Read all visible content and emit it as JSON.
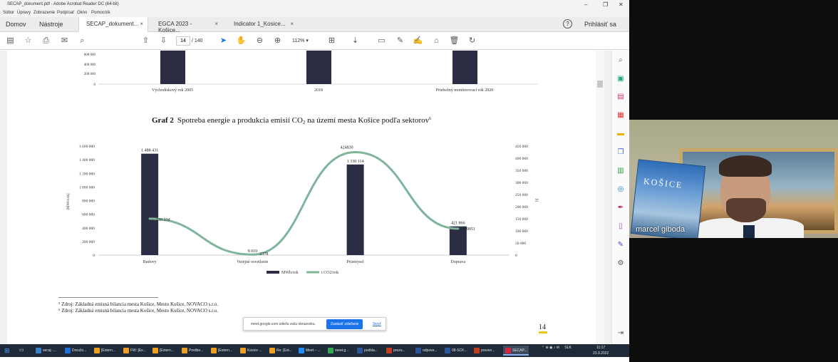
{
  "window": {
    "title": "SECAP_dokument.pdf - Adobe Acrobat Reader DC (64-bit)",
    "min": "–",
    "max": "❐",
    "close": "✕"
  },
  "menu": [
    "Súbor",
    "Úpravy",
    "Zobrazenie",
    "Podpísať",
    "Okno",
    "Pomocník"
  ],
  "tabs": {
    "home": "Domov",
    "tools": "Nástroje",
    "docs": [
      {
        "label": "SECAP_dokument...",
        "active": true
      },
      {
        "label": "EGCA 2023 - Košice...",
        "active": false
      },
      {
        "label": "Indicator 1_Kosice...",
        "active": false
      }
    ],
    "close_glyph": "×",
    "help": "?",
    "login": "Prihlásiť sa"
  },
  "toolbar": {
    "page_current": "14",
    "page_total": "/ 140",
    "zoom": "112%"
  },
  "chart_top": {
    "yticks": [
      "600 000",
      "400 000",
      "200 000",
      "0"
    ],
    "categories": [
      "Východiskový rok 2005",
      "2018",
      "Priebežný monitorovací rok 2020"
    ]
  },
  "chart_data": {
    "type": "bar",
    "title": "Graf 2",
    "subtitle": "Spotreba energie a produkcia emisií CO",
    "subtitle_sub": "2",
    "subtitle_tail": " na území mesta Košice podľa sektorov",
    "subtitle_sup": "6",
    "categories": [
      "Budovy",
      "Verejné osvetlenie",
      "Priemysel",
      "Doprava"
    ],
    "series": [
      {
        "name": "MWh/rok",
        "type": "bar",
        "values": [
          1488431,
          9019,
          1330114,
          421866
        ],
        "color": "#2b2d45"
      },
      {
        "name": "t CO2/rok",
        "type": "line",
        "values": [
          150234,
          2378,
          424830,
          109051
        ],
        "color": "#7fb59a"
      }
    ],
    "bar_labels": [
      "1 488 431",
      "9 019",
      "1 330 114",
      "421 866"
    ],
    "line_labels": [
      "150 234",
      "2378",
      "424830",
      "109051"
    ],
    "ylabel_left": "[MWh/rok]",
    "ylabel_right": "[t]",
    "ylim_left": [
      0,
      1600000
    ],
    "ylim_right": [
      0,
      450000
    ],
    "yticks_left": [
      "1 600 000",
      "1 400 000",
      "1 200 000",
      "1 000 000",
      "800 000",
      "600 000",
      "400 000",
      "200 000",
      "0"
    ],
    "yticks_right": [
      "450 000",
      "400 000",
      "350 000",
      "300 000",
      "250 000",
      "200 000",
      "150 000",
      "100 000",
      "50 000",
      "0"
    ],
    "legend": "bottom"
  },
  "footnotes": [
    "⁵ Zdroj: Základná emisná bilancia mesta Košice, Mesto Košice, NOVACO s.r.o.",
    "⁶ Zdroj: Základná emisná bilancia mesta Košice, Mesto Košice, NOVACO s.r.o."
  ],
  "page_number": "14",
  "share_bar": {
    "text": "meet.google.com zdieľa vašu obrazovku.",
    "stop": "Zastaviť zdieľanie",
    "hide": "Skryť"
  },
  "taskbar": {
    "items": [
      "secaj -...",
      "Doručo...",
      "[Extern...",
      "FW: [Ex...",
      "[Extern...",
      "Predbe...",
      "[Extern...",
      "Kosice ...",
      "Re: [Ext...",
      "Meet – ...",
      "meet.g...",
      "podkla...",
      "prezo...",
      "odpove...",
      "08-SCK...",
      "prezen...",
      "SECAP..."
    ],
    "lang": "SLK",
    "time": "11:17",
    "date": "23.9.2022"
  },
  "video": {
    "participant": "marcel giboda",
    "book_title": "KOŠICE"
  }
}
